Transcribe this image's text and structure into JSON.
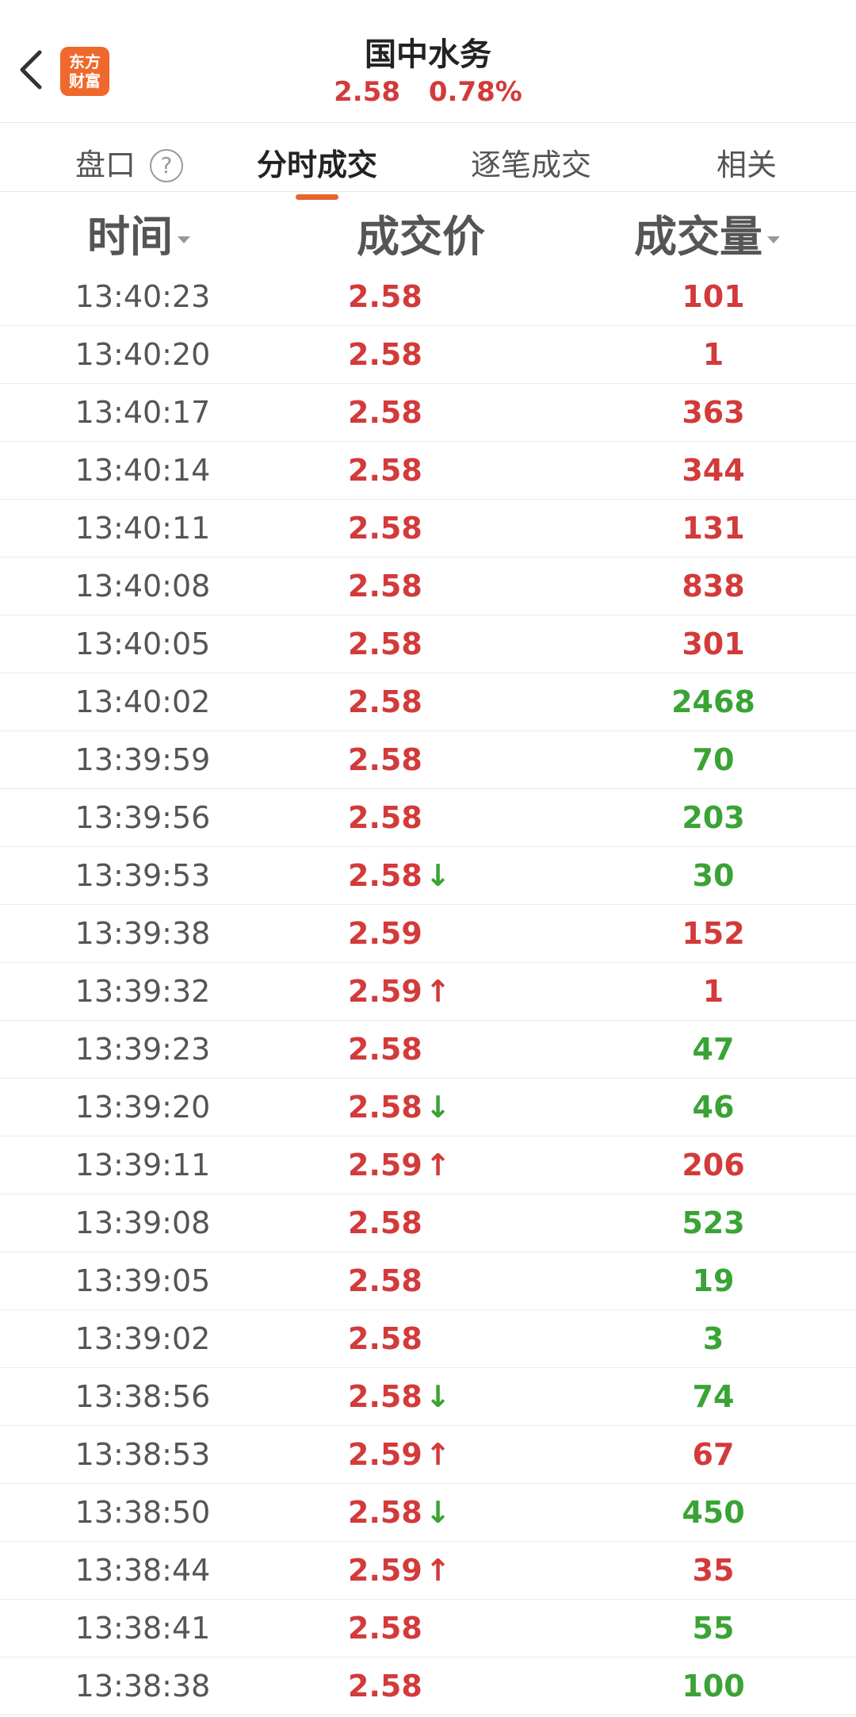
{
  "header": {
    "title": "国中水务",
    "price": "2.58",
    "change": "0.78%",
    "logo_line1": "东方",
    "logo_line2": "财富"
  },
  "tabs": [
    {
      "label": "盘口"
    },
    {
      "label": "分时成交"
    },
    {
      "label": "逐笔成交"
    },
    {
      "label": "相关"
    }
  ],
  "columns": {
    "time": "时间",
    "price": "成交价",
    "volume": "成交量"
  },
  "rows": [
    {
      "time": "13:40:23",
      "price": "2.58",
      "arrow": "",
      "vol": "101",
      "dir": "up"
    },
    {
      "time": "13:40:20",
      "price": "2.58",
      "arrow": "",
      "vol": "1",
      "dir": "up"
    },
    {
      "time": "13:40:17",
      "price": "2.58",
      "arrow": "",
      "vol": "363",
      "dir": "up"
    },
    {
      "time": "13:40:14",
      "price": "2.58",
      "arrow": "",
      "vol": "344",
      "dir": "up"
    },
    {
      "time": "13:40:11",
      "price": "2.58",
      "arrow": "",
      "vol": "131",
      "dir": "up"
    },
    {
      "time": "13:40:08",
      "price": "2.58",
      "arrow": "",
      "vol": "838",
      "dir": "up"
    },
    {
      "time": "13:40:05",
      "price": "2.58",
      "arrow": "",
      "vol": "301",
      "dir": "up"
    },
    {
      "time": "13:40:02",
      "price": "2.58",
      "arrow": "",
      "vol": "2468",
      "dir": "down"
    },
    {
      "time": "13:39:59",
      "price": "2.58",
      "arrow": "",
      "vol": "70",
      "dir": "down"
    },
    {
      "time": "13:39:56",
      "price": "2.58",
      "arrow": "",
      "vol": "203",
      "dir": "down"
    },
    {
      "time": "13:39:53",
      "price": "2.58",
      "arrow": "↓",
      "vol": "30",
      "dir": "down"
    },
    {
      "time": "13:39:38",
      "price": "2.59",
      "arrow": "",
      "vol": "152",
      "dir": "up"
    },
    {
      "time": "13:39:32",
      "price": "2.59",
      "arrow": "↑",
      "vol": "1",
      "dir": "up"
    },
    {
      "time": "13:39:23",
      "price": "2.58",
      "arrow": "",
      "vol": "47",
      "dir": "down"
    },
    {
      "time": "13:39:20",
      "price": "2.58",
      "arrow": "↓",
      "vol": "46",
      "dir": "down"
    },
    {
      "time": "13:39:11",
      "price": "2.59",
      "arrow": "↑",
      "vol": "206",
      "dir": "up"
    },
    {
      "time": "13:39:08",
      "price": "2.58",
      "arrow": "",
      "vol": "523",
      "dir": "down"
    },
    {
      "time": "13:39:05",
      "price": "2.58",
      "arrow": "",
      "vol": "19",
      "dir": "down"
    },
    {
      "time": "13:39:02",
      "price": "2.58",
      "arrow": "",
      "vol": "3",
      "dir": "down"
    },
    {
      "time": "13:38:56",
      "price": "2.58",
      "arrow": "↓",
      "vol": "74",
      "dir": "down"
    },
    {
      "time": "13:38:53",
      "price": "2.59",
      "arrow": "↑",
      "vol": "67",
      "dir": "up"
    },
    {
      "time": "13:38:50",
      "price": "2.58",
      "arrow": "↓",
      "vol": "450",
      "dir": "down"
    },
    {
      "time": "13:38:44",
      "price": "2.59",
      "arrow": "↑",
      "vol": "35",
      "dir": "up"
    },
    {
      "time": "13:38:41",
      "price": "2.58",
      "arrow": "",
      "vol": "55",
      "dir": "down"
    },
    {
      "time": "13:38:38",
      "price": "2.58",
      "arrow": "",
      "vol": "100",
      "dir": "down"
    }
  ],
  "colors": {
    "up": "#d33a3a",
    "down": "#3aa335",
    "accent": "#e8642c"
  }
}
